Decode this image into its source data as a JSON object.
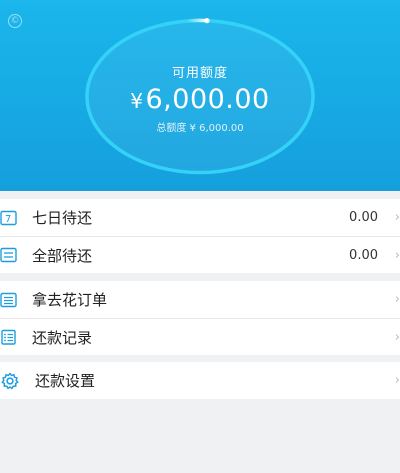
{
  "header": {
    "available_label": "可用额度",
    "currency_symbol": "¥",
    "available_amount": "6,000.00",
    "total_line": "总额度 ¥ 6,000.00",
    "colors": {
      "background": "#159fdd",
      "ring": "#35d3f6"
    }
  },
  "menu": {
    "seven_day": {
      "label": "七日待还",
      "value": "0.00",
      "icon": "calendar-7-icon"
    },
    "all_due": {
      "label": "全部待还",
      "value": "0.00",
      "icon": "list-icon"
    },
    "orders": {
      "label": "拿去花订单",
      "icon": "order-list-icon"
    },
    "repay_records": {
      "label": "还款记录",
      "icon": "record-icon"
    },
    "repay_settings": {
      "label": "还款设置",
      "icon": "gear-icon"
    }
  },
  "chevron": "›"
}
